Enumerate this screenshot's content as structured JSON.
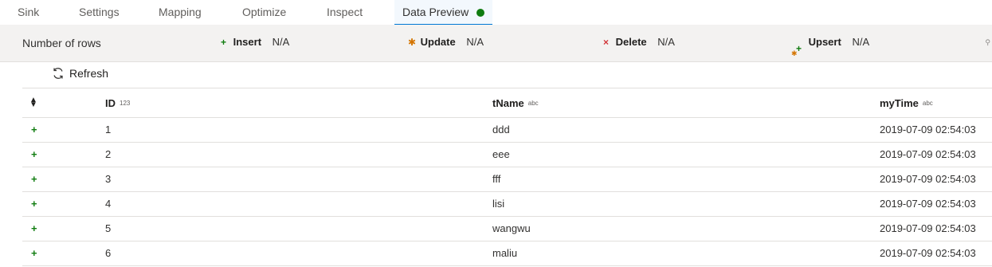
{
  "tabs": [
    {
      "label": "Sink"
    },
    {
      "label": "Settings"
    },
    {
      "label": "Mapping"
    },
    {
      "label": "Optimize"
    },
    {
      "label": "Inspect"
    },
    {
      "label": "Data Preview",
      "active": true,
      "status_color": "#107c10"
    }
  ],
  "stats": {
    "rows_label": "Number of rows",
    "insert": {
      "icon": "plus-icon",
      "label": "Insert",
      "value": "N/A"
    },
    "update": {
      "icon": "asterisk-icon",
      "label": "Update",
      "value": "N/A"
    },
    "delete": {
      "icon": "x-icon",
      "label": "Delete",
      "value": "N/A"
    },
    "upsert": {
      "icon": "upsert-icon",
      "label": "Upsert",
      "value": "N/A"
    }
  },
  "refresh": {
    "label": "Refresh",
    "icon": "refresh-icon"
  },
  "table": {
    "columns": [
      {
        "name": "ID",
        "type": "123"
      },
      {
        "name": "tName",
        "type": "abc"
      },
      {
        "name": "myTime",
        "type": "abc"
      }
    ],
    "rows": [
      {
        "mark": "+",
        "id": "1",
        "tName": "ddd",
        "myTime": "2019-07-09 02:54:03"
      },
      {
        "mark": "+",
        "id": "2",
        "tName": "eee",
        "myTime": "2019-07-09 02:54:03"
      },
      {
        "mark": "+",
        "id": "3",
        "tName": "fff",
        "myTime": "2019-07-09 02:54:03"
      },
      {
        "mark": "+",
        "id": "4",
        "tName": "lisi",
        "myTime": "2019-07-09 02:54:03"
      },
      {
        "mark": "+",
        "id": "5",
        "tName": "wangwu",
        "myTime": "2019-07-09 02:54:03"
      },
      {
        "mark": "+",
        "id": "6",
        "tName": "maliu",
        "myTime": "2019-07-09 02:54:03"
      }
    ]
  },
  "colors": {
    "accent": "#0078d4",
    "success": "#107c10",
    "update": "#d47500",
    "delete": "#d13438"
  }
}
